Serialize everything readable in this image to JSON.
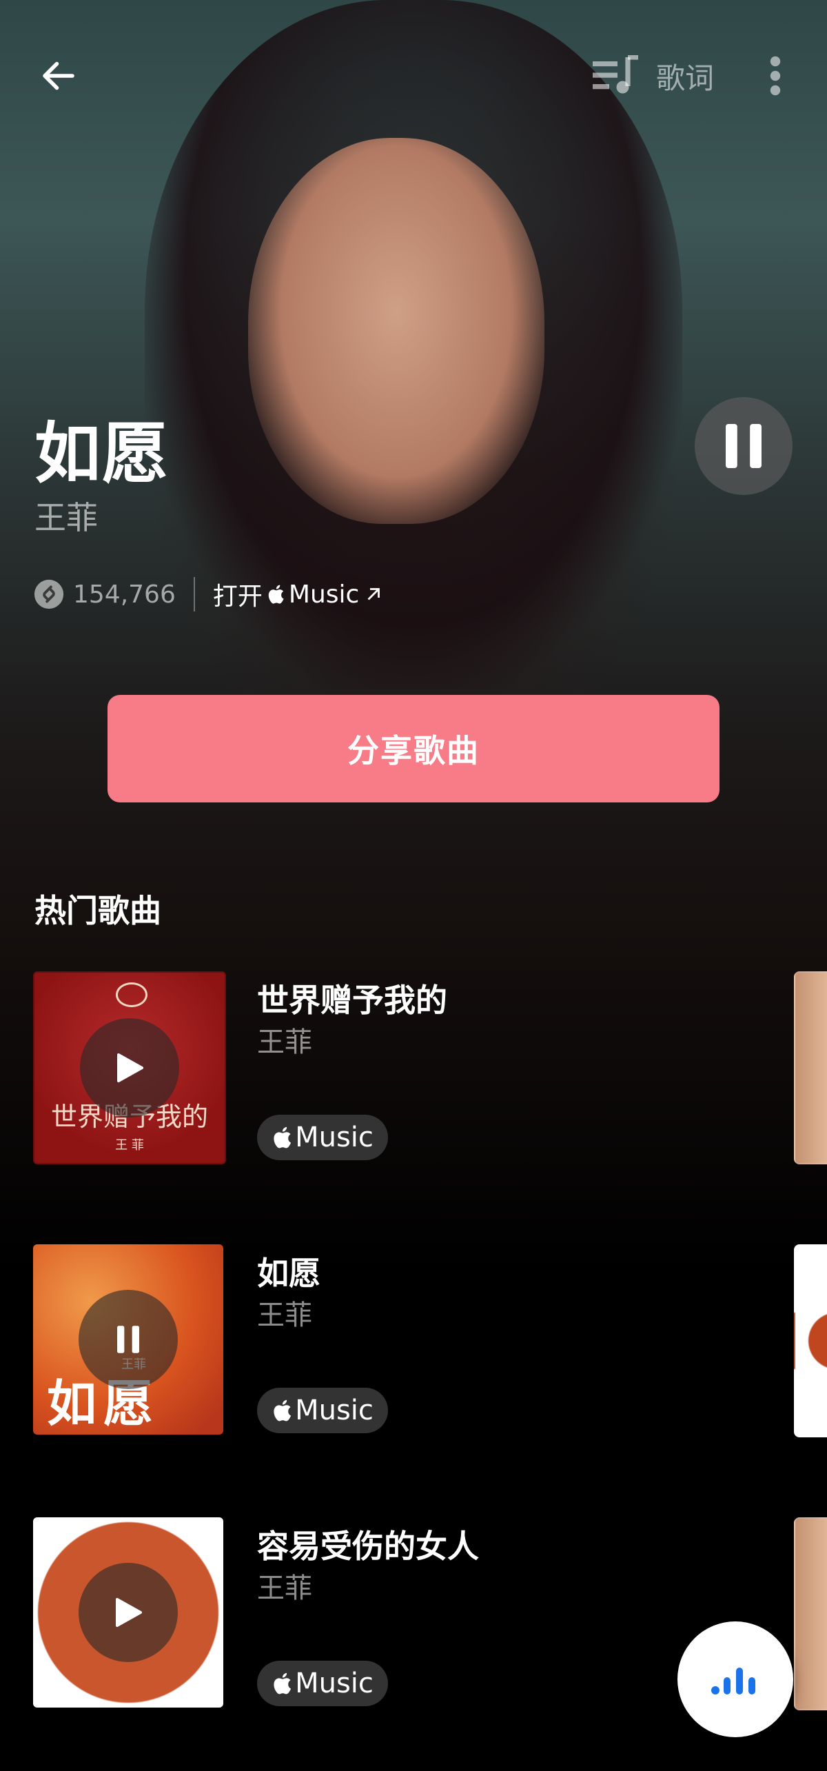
{
  "header": {
    "back_icon": "arrow-left-icon",
    "lyrics_label": "歌词",
    "more_icon": "more-vertical-icon"
  },
  "song": {
    "title": "如愿",
    "artist": "王菲",
    "shazam_count": "154,766",
    "open_prefix": "打开",
    "open_app": "Music",
    "playing": true
  },
  "share_button": "分享歌曲",
  "top_songs": {
    "heading": "热门歌曲",
    "items": [
      {
        "title": "世界赠予我的",
        "artist": "王菲",
        "badge": "Music",
        "state": "play",
        "cover_text": "世界赠予我的",
        "cover_sub": "王 菲"
      },
      {
        "title": "如愿",
        "artist": "王菲",
        "badge": "Music",
        "state": "pause",
        "cover_text": "如愿",
        "cover_sub": "王菲"
      },
      {
        "title": "容易受伤的女人",
        "artist": "王菲",
        "badge": "Music",
        "state": "play"
      }
    ]
  },
  "colors": {
    "accent": "#f77c87",
    "fab_bars": "#1a73e8"
  }
}
